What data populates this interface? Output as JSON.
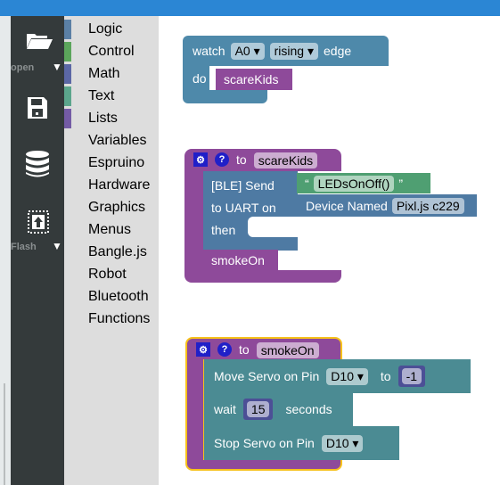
{
  "toolbar": {
    "open_label": "open",
    "flash_label": "Flash",
    "icons": [
      "folder-open-icon",
      "save-icon",
      "database-icon",
      "flash-upload-icon"
    ]
  },
  "categories": [
    {
      "label": "Logic",
      "color": "#5b80a5"
    },
    {
      "label": "Control",
      "color": "#5ba55b"
    },
    {
      "label": "Math",
      "color": "#5b67a5"
    },
    {
      "label": "Text",
      "color": "#5ba58c"
    },
    {
      "label": "Lists",
      "color": "#745ba5"
    },
    {
      "label": "Variables"
    },
    {
      "label": "Espruino"
    },
    {
      "label": "Hardware"
    },
    {
      "label": "Graphics"
    },
    {
      "label": "Menus"
    },
    {
      "label": "Bangle.js"
    },
    {
      "label": "Robot"
    },
    {
      "label": "Bluetooth"
    },
    {
      "label": "Functions"
    }
  ],
  "watch_block": {
    "watch": "watch",
    "pin": "A0",
    "edge_type": "rising",
    "edge": "edge",
    "do": "do",
    "call": "scareKids"
  },
  "scare_block": {
    "to": "to",
    "name": "scareKids",
    "ble_send": "[BLE] Send",
    "open_quote": "“",
    "string": "LEDsOnOff()",
    "close_quote": "”",
    "to_uart": "to UART on",
    "device_named": "Device Named",
    "device": "Pixl.js c229",
    "then": "then",
    "call": "smokeOn"
  },
  "smoke_block": {
    "to": "to",
    "name": "smokeOn",
    "move_servo": "Move Servo on Pin",
    "pin1": "D10",
    "to2": "to",
    "value": "-1",
    "wait": "wait",
    "seconds_value": "15",
    "seconds": "seconds",
    "stop_servo": "Stop Servo on Pin",
    "pin2": "D10"
  },
  "colors": {
    "accent": "#2b86d4",
    "procedure": "#8e4a9a",
    "selected_outline": "#f7c11a"
  }
}
